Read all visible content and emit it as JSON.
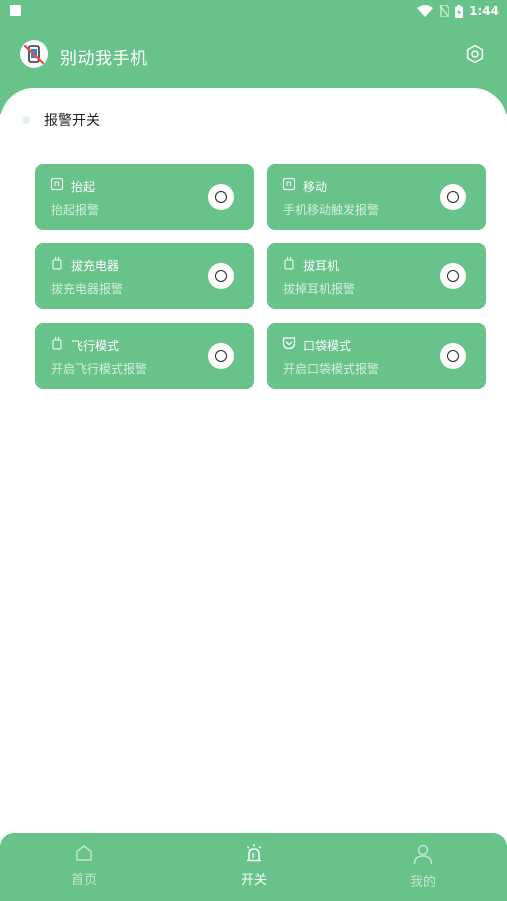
{
  "status_bar": {
    "time": "1:44"
  },
  "app_bar": {
    "title": "别动我手机"
  },
  "section": {
    "title": "报警开关"
  },
  "cards": [
    {
      "title": "抬起",
      "subtitle": "抬起报警",
      "icon": "phone-lift-icon",
      "enabled": false
    },
    {
      "title": "移动",
      "subtitle": "手机移动触发报警",
      "icon": "phone-move-icon",
      "enabled": false
    },
    {
      "title": "拔充电器",
      "subtitle": "拔充电器报警",
      "icon": "plug-icon",
      "enabled": false
    },
    {
      "title": "拔耳机",
      "subtitle": "拔掉耳机报警",
      "icon": "plug-icon",
      "enabled": false
    },
    {
      "title": "飞行模式",
      "subtitle": "开启飞行模式报警",
      "icon": "plug-icon",
      "enabled": false
    },
    {
      "title": "口袋模式",
      "subtitle": "开启口袋模式报警",
      "icon": "pocket-icon",
      "enabled": false
    }
  ],
  "bottom_nav": {
    "items": [
      {
        "label": "首页",
        "icon": "home-icon",
        "active": false
      },
      {
        "label": "开关",
        "icon": "alarm-icon",
        "active": true
      },
      {
        "label": "我的",
        "icon": "user-icon",
        "active": false
      }
    ]
  },
  "colors": {
    "primary": "#67c38a",
    "background": "#ffffff",
    "text": "#222222"
  }
}
